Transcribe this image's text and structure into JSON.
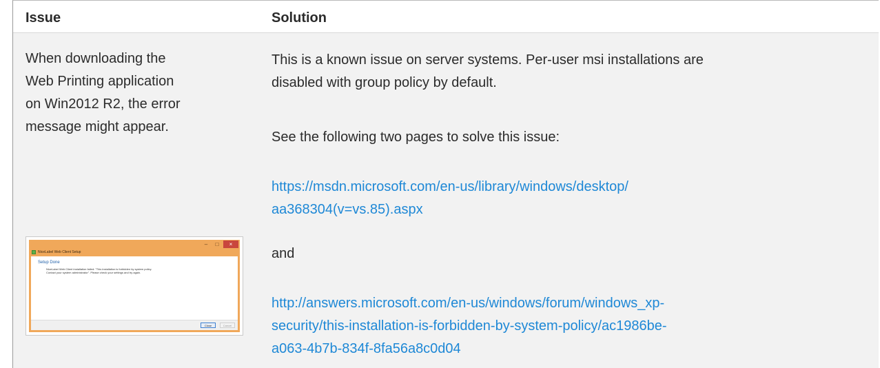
{
  "table": {
    "headers": {
      "issue": "Issue",
      "solution": "Solution"
    },
    "issue_lines": [
      "When downloading the",
      "Web Printing application",
      "on Win2012 R2, the error",
      "message might appear."
    ],
    "screenshot": {
      "window_title": "NiceLabel Web Client Setup",
      "minimize": "–",
      "maximize": "□",
      "close": "×",
      "heading": "Setup Done",
      "message_lines": [
        "NiceLabel Web Client installation failed: \"This installation is forbidden by system policy.",
        "Contact your system administrator\". Please check your settings and try again."
      ],
      "close_button": "Close",
      "cancel_button": "Cancel"
    },
    "solution": {
      "p1_lines": [
        "This is a known issue on server systems. Per-user msi installations are",
        "disabled with group policy by default."
      ],
      "p2": "See the following two pages to solve this issue:",
      "link1_lines": [
        "https://msdn.microsoft.com/en-us/library/windows/desktop/",
        "aa368304(v=vs.85).aspx"
      ],
      "and": "and",
      "link2_lines": [
        "http://answers.microsoft.com/en-us/windows/forum/windows_xp-",
        "security/this-installation-is-forbidden-by-system-policy/ac1986be-",
        "a063-4b7b-834f-8fa56a8c0d04"
      ]
    }
  },
  "colors": {
    "link": "#1e88d6",
    "row_background": "#f2f2f2",
    "header_background": "#ffffff",
    "window_accent": "#f0a85a"
  }
}
